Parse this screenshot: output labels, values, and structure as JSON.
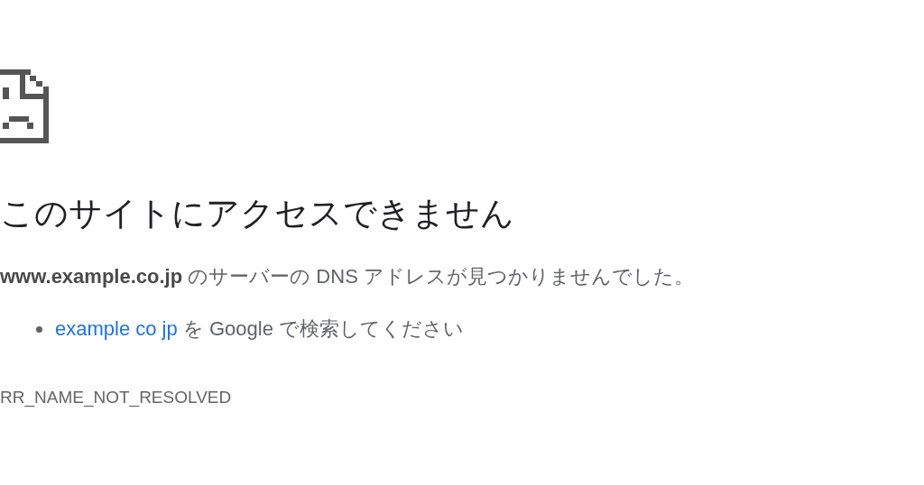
{
  "title": "このサイトにアクセスできません",
  "message": "**www.example.co.jp** のサーバーの DNS アドレスが見つかりませんでした。",
  "suggestions": [
    {
      "link": "example co jp",
      "text": " を Google で検索してください"
    }
  ],
  "error_code": "RR_NAME_NOT_RESOLVED"
}
